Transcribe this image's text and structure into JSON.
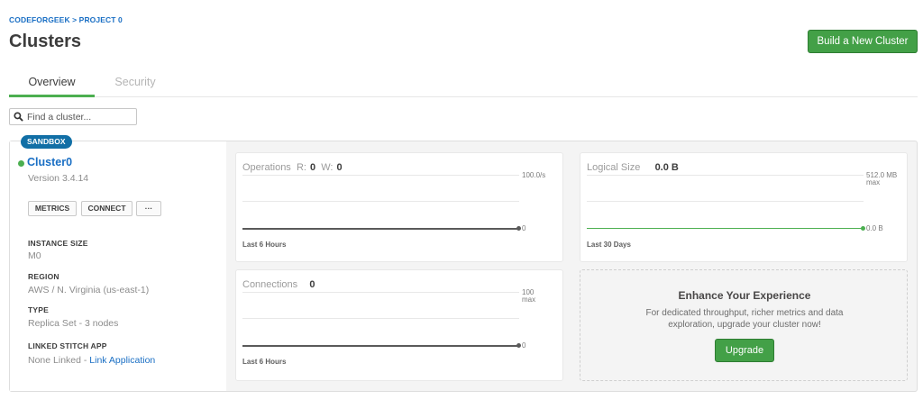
{
  "breadcrumb": "CODEFORGEEK > PROJECT 0",
  "page_title": "Clusters",
  "build_button_label": "Build a New Cluster",
  "tabs": [
    {
      "label": "Overview",
      "active": true
    },
    {
      "label": "Security",
      "active": false
    }
  ],
  "search": {
    "placeholder": "Find a cluster...",
    "value": ""
  },
  "cluster": {
    "tier_badge": "SANDBOX",
    "name": "Cluster0",
    "status_color": "#4caf50",
    "version": "Version 3.4.14",
    "actions": {
      "metrics": "METRICS",
      "connect": "CONNECT",
      "more": "···"
    },
    "instance_size_label": "INSTANCE SIZE",
    "instance_size": "M0",
    "region_label": "REGION",
    "region": "AWS / N. Virginia (us-east-1)",
    "type_label": "TYPE",
    "type": "Replica Set - 3 nodes",
    "linked_stitch_label": "LINKED STITCH APP",
    "linked_stitch_value": "None Linked - ",
    "link_application": "Link Application"
  },
  "charts": {
    "operations": {
      "title": "Operations",
      "r_label": "R:",
      "r_value": "0",
      "w_label": "W:",
      "w_value": "0",
      "max_label": "100.0/s",
      "zero_label": "0",
      "range": "Last 6 Hours"
    },
    "logical_size": {
      "title": "Logical Size",
      "value": "0.0 B",
      "max_label": "512.0 MB",
      "max_suffix": "max",
      "zero_label": "0.0 B",
      "range": "Last 30 Days",
      "line_color": "#4caf50"
    },
    "connections": {
      "title": "Connections",
      "value": "0",
      "max_label": "100",
      "max_suffix": "max",
      "zero_label": "0",
      "range": "Last 6 Hours"
    }
  },
  "promo": {
    "title": "Enhance Your Experience",
    "text": "For dedicated throughput, richer metrics and data exploration, upgrade your cluster now!",
    "button": "Upgrade"
  },
  "colors": {
    "accent_green": "#43a047",
    "link_blue": "#1a6fc4",
    "badge_blue": "#116fa6"
  }
}
